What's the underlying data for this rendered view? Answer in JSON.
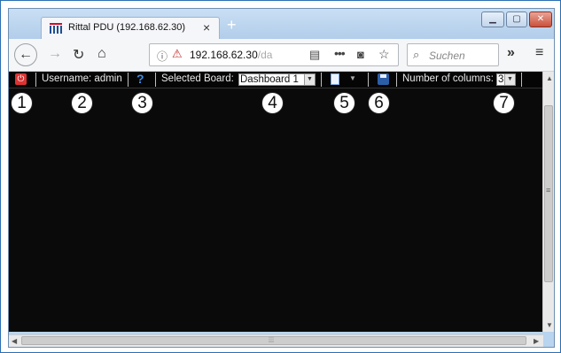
{
  "browser": {
    "tab_title": "Rittal PDU (192.168.62.30)",
    "tab_close": "×",
    "new_tab": "+",
    "url_host": "192.168.62.30",
    "url_path": "/da",
    "search_placeholder": "Suchen",
    "overflow_label": "»",
    "menu_label": "≡"
  },
  "pdu_toolbar": {
    "username_label": "Username: admin",
    "help_label": "?",
    "board_label": "Selected Board:",
    "board_value": "Dashboard 1",
    "columns_label": "Number of columns:",
    "columns_value": "3"
  },
  "callouts": [
    "1",
    "2",
    "3",
    "4",
    "5",
    "6",
    "7"
  ],
  "colors": {
    "page_background": "#0a0a0a",
    "toolbar_text": "#e8e8e8",
    "power_icon": "#dd3333",
    "help_icon": "#3b8ee6"
  }
}
